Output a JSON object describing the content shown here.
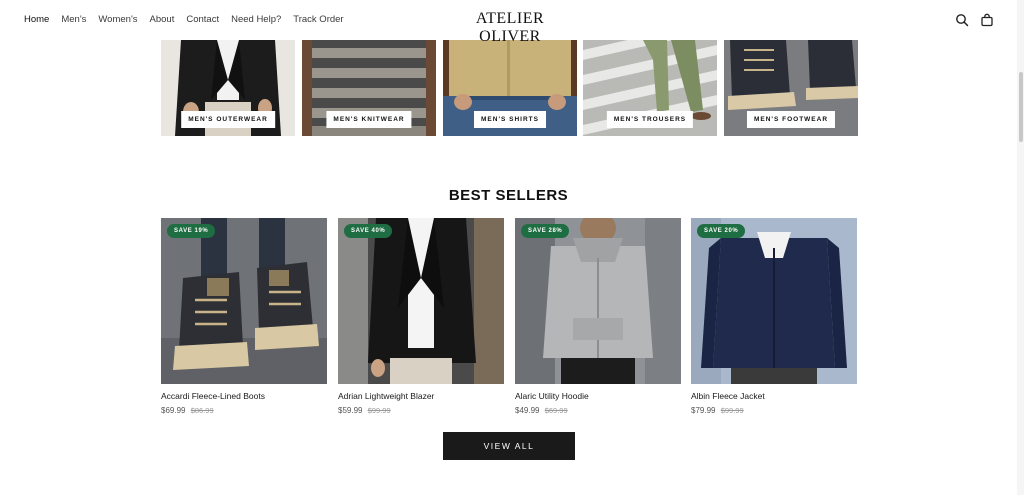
{
  "header": {
    "nav": [
      "Home",
      "Men's",
      "Women's",
      "About",
      "Contact",
      "Need Help?",
      "Track Order"
    ],
    "logo": "ATELIER OLIVER",
    "icons": [
      "search-icon",
      "shopping-bag-icon"
    ]
  },
  "categories": [
    {
      "label": "MEN'S OUTERWEAR",
      "image": "blazer-torso"
    },
    {
      "label": "MEN'S KNITWEAR",
      "image": "striped-sweater"
    },
    {
      "label": "MEN'S SHIRTS",
      "image": "khaki-shirt-jeans"
    },
    {
      "label": "MEN'S TROUSERS",
      "image": "green-trousers-crosswalk"
    },
    {
      "label": "MEN'S FOOTWEAR",
      "image": "lace-up-boots"
    }
  ],
  "best_sellers": {
    "title": "BEST SELLERS",
    "products": [
      {
        "badge": "SAVE 19%",
        "name": "Accardi Fleece-Lined Boots",
        "price": "$69.99",
        "old_price": "$86.99"
      },
      {
        "badge": "SAVE 40%",
        "name": "Adrian Lightweight Blazer",
        "price": "$59.99",
        "old_price": "$99.99"
      },
      {
        "badge": "SAVE 28%",
        "name": "Alaric Utility Hoodie",
        "price": "$49.99",
        "old_price": "$69.99"
      },
      {
        "badge": "SAVE 20%",
        "name": "Albin Fleece Jacket",
        "price": "$79.99",
        "old_price": "$99.99"
      }
    ],
    "button": "VIEW ALL"
  },
  "colors": {
    "badge": "#1f6d43",
    "button": "#1a1a1a"
  }
}
